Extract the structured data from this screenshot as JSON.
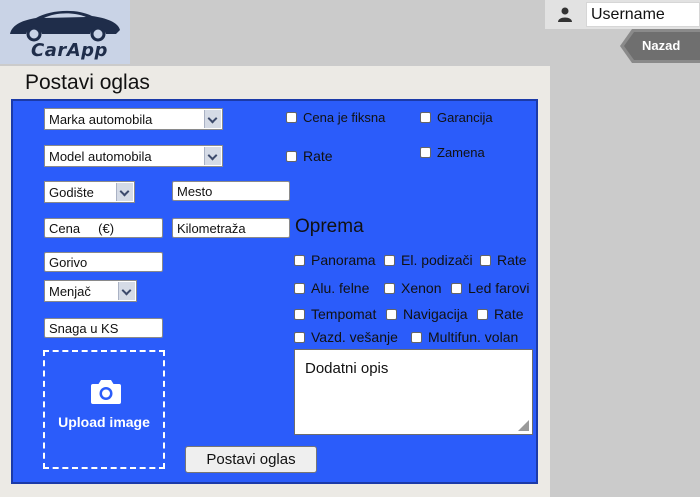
{
  "brand": {
    "name": "CarApp"
  },
  "user": {
    "username": "Username"
  },
  "nav": {
    "back_label": "Nazad"
  },
  "page": {
    "title": "Postavi oglas"
  },
  "form": {
    "make_select": "Marka automobila",
    "model_select": "Model automobila",
    "year_select": "Godište",
    "city_input": "Mesto",
    "price_input": "Cena     (€)",
    "mileage_input": "Kilometraža",
    "fuel_input": "Gorivo",
    "gearbox_select": "Menjač",
    "power_input": "Snaga u KS",
    "options": {
      "fixed_price": "Cena je fiksna",
      "warranty": "Garancija",
      "installments": "Rate",
      "exchange": "Zamena"
    },
    "equipment_title": "Oprema",
    "equipment": {
      "panorama": "Panorama",
      "power_windows": "El. podizači",
      "installments": "Rate",
      "alloy_wheels": "Alu. felne",
      "xenon": "Xenon",
      "led_lights": "Led farovi",
      "cruise_control": "Tempomat",
      "navigation": "Navigacija",
      "installments_2": "Rate",
      "air_suspension": "Vazd. vešanje",
      "multifunction_wheel": "Multifun. volan"
    },
    "upload_label": "Upload image",
    "description_placeholder": "Dodatni opis",
    "submit_label": "Postavi oglas"
  }
}
